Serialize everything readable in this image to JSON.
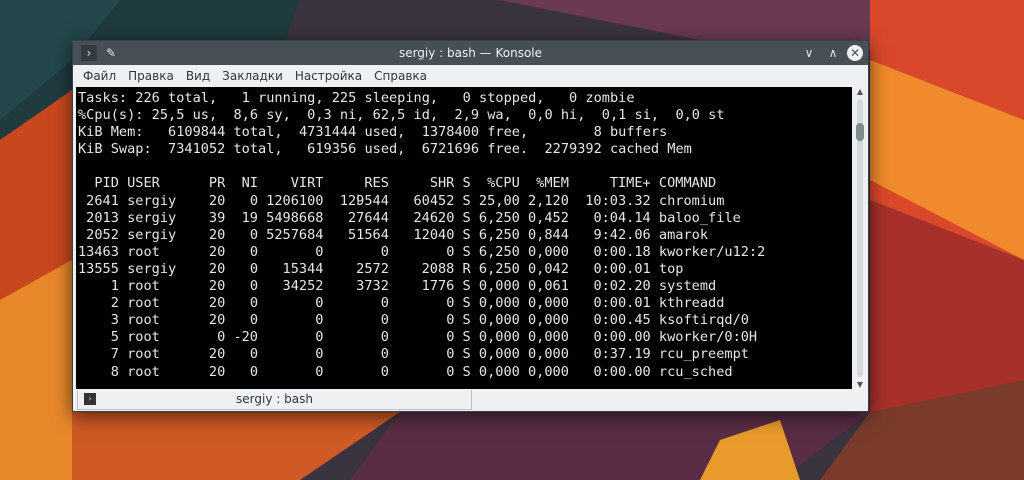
{
  "window": {
    "title": "sergiy : bash — Konsole"
  },
  "menu": [
    "Файл",
    "Правка",
    "Вид",
    "Закладки",
    "Настройка",
    "Справка"
  ],
  "summary": [
    "Tasks: 226 total,   1 running, 225 sleeping,   0 stopped,   0 zombie",
    "%Cpu(s): 25,5 us,  8,6 sy,  0,3 ni, 62,5 id,  2,9 wa,  0,0 hi,  0,1 si,  0,0 st",
    "KiB Mem:   6109844 total,  4731444 used,  1378400 free,        8 buffers",
    "KiB Swap:  7341052 total,   619356 used,  6721696 free.  2279392 cached Mem"
  ],
  "columns": [
    "PID",
    "USER",
    "PR",
    "NI",
    "VIRT",
    "RES",
    "SHR",
    "S",
    "%CPU",
    "%MEM",
    "TIME+",
    "COMMAND"
  ],
  "processes": [
    [
      "2641",
      "sergiy",
      "20",
      "0",
      "1206100",
      "129544",
      "60452",
      "S",
      "25,00",
      "2,120",
      "10:03.32",
      "chromium"
    ],
    [
      "2013",
      "sergiy",
      "39",
      "19",
      "5498668",
      "27644",
      "24620",
      "S",
      "6,250",
      "0,452",
      "0:04.14",
      "baloo_file"
    ],
    [
      "2052",
      "sergiy",
      "20",
      "0",
      "5257684",
      "51564",
      "12040",
      "S",
      "6,250",
      "0,844",
      "9:42.06",
      "amarok"
    ],
    [
      "13463",
      "root",
      "20",
      "0",
      "0",
      "0",
      "0",
      "S",
      "6,250",
      "0,000",
      "0:00.18",
      "kworker/u12:2"
    ],
    [
      "13555",
      "sergiy",
      "20",
      "0",
      "15344",
      "2572",
      "2088",
      "R",
      "6,250",
      "0,042",
      "0:00.01",
      "top"
    ],
    [
      "1",
      "root",
      "20",
      "0",
      "34252",
      "3732",
      "1776",
      "S",
      "0,000",
      "0,061",
      "0:02.20",
      "systemd"
    ],
    [
      "2",
      "root",
      "20",
      "0",
      "0",
      "0",
      "0",
      "S",
      "0,000",
      "0,000",
      "0:00.01",
      "kthreadd"
    ],
    [
      "3",
      "root",
      "20",
      "0",
      "0",
      "0",
      "0",
      "S",
      "0,000",
      "0,000",
      "0:00.45",
      "ksoftirqd/0"
    ],
    [
      "5",
      "root",
      "0",
      "-20",
      "0",
      "0",
      "0",
      "S",
      "0,000",
      "0,000",
      "0:00.00",
      "kworker/0:0H"
    ],
    [
      "7",
      "root",
      "20",
      "0",
      "0",
      "0",
      "0",
      "S",
      "0,000",
      "0,000",
      "0:37.19",
      "rcu_preempt"
    ],
    [
      "8",
      "root",
      "20",
      "0",
      "0",
      "0",
      "0",
      "S",
      "0,000",
      "0,000",
      "0:00.00",
      "rcu_sched"
    ]
  ],
  "tab": {
    "label": "sergiy : bash"
  }
}
